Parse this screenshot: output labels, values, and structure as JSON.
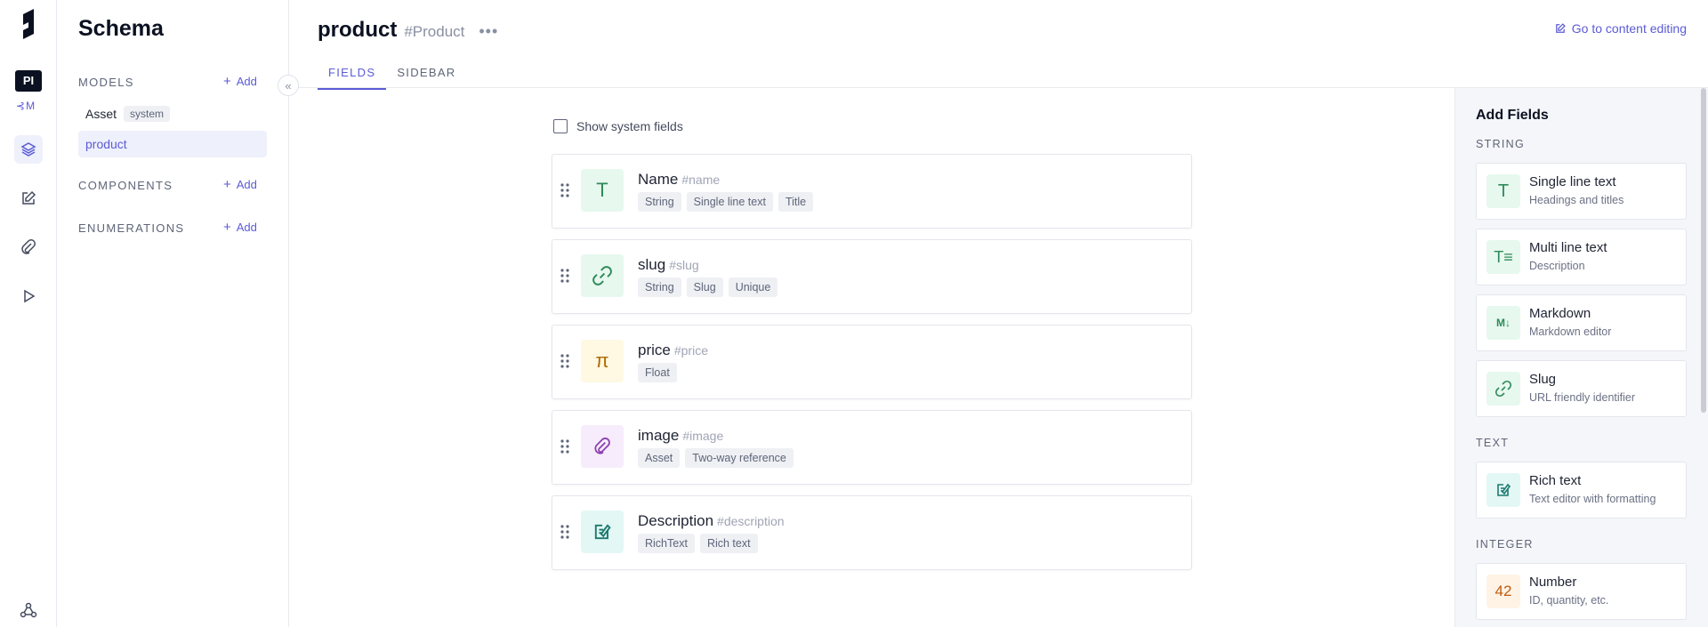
{
  "rail": {
    "project_initials": "PI",
    "env_label": "M",
    "nav_icons": [
      "layers-icon",
      "edit-icon",
      "paperclip-icon",
      "play-icon"
    ],
    "bottom_icon": "webhook-icon"
  },
  "schema": {
    "title": "Schema",
    "models_label": "MODELS",
    "components_label": "COMPONENTS",
    "enumerations_label": "ENUMERATIONS",
    "add_label": "Add",
    "models": [
      {
        "name": "Asset",
        "badge": "system"
      },
      {
        "name": "product",
        "badge": ""
      }
    ]
  },
  "header": {
    "model_name": "product",
    "model_api_id": "#Product",
    "more": "•••",
    "goto_label": "Go to content editing",
    "tabs": [
      "FIELDS",
      "SIDEBAR"
    ]
  },
  "main": {
    "show_system_fields": "Show system fields",
    "fields": [
      {
        "name": "Name",
        "api_id": "#name",
        "icon": "text-icon",
        "tags": [
          "String",
          "Single line text",
          "Title"
        ]
      },
      {
        "name": "slug",
        "api_id": "#slug",
        "icon": "link-icon",
        "tags": [
          "String",
          "Slug",
          "Unique"
        ]
      },
      {
        "name": "price",
        "api_id": "#price",
        "icon": "pi-icon",
        "tags": [
          "Float"
        ]
      },
      {
        "name": "image",
        "api_id": "#image",
        "icon": "paperclip-icon",
        "tags": [
          "Asset",
          "Two-way reference"
        ]
      },
      {
        "name": "Description",
        "api_id": "#description",
        "icon": "rich-text-icon",
        "tags": [
          "RichText",
          "Rich text"
        ]
      }
    ]
  },
  "add_fields": {
    "title": "Add Fields",
    "groups": [
      {
        "label": "STRING",
        "items": [
          {
            "name": "Single line text",
            "desc": "Headings and titles"
          },
          {
            "name": "Multi line text",
            "desc": "Description"
          },
          {
            "name": "Markdown",
            "desc": "Markdown editor"
          },
          {
            "name": "Slug",
            "desc": "URL friendly identifier"
          }
        ]
      },
      {
        "label": "TEXT",
        "items": [
          {
            "name": "Rich text",
            "desc": "Text editor with formatting"
          }
        ]
      },
      {
        "label": "INTEGER",
        "items": [
          {
            "name": "Number",
            "desc": "ID, quantity, etc."
          }
        ]
      }
    ]
  },
  "colors": {
    "accent": "#5b5bd6",
    "dark": "#0b1121"
  }
}
